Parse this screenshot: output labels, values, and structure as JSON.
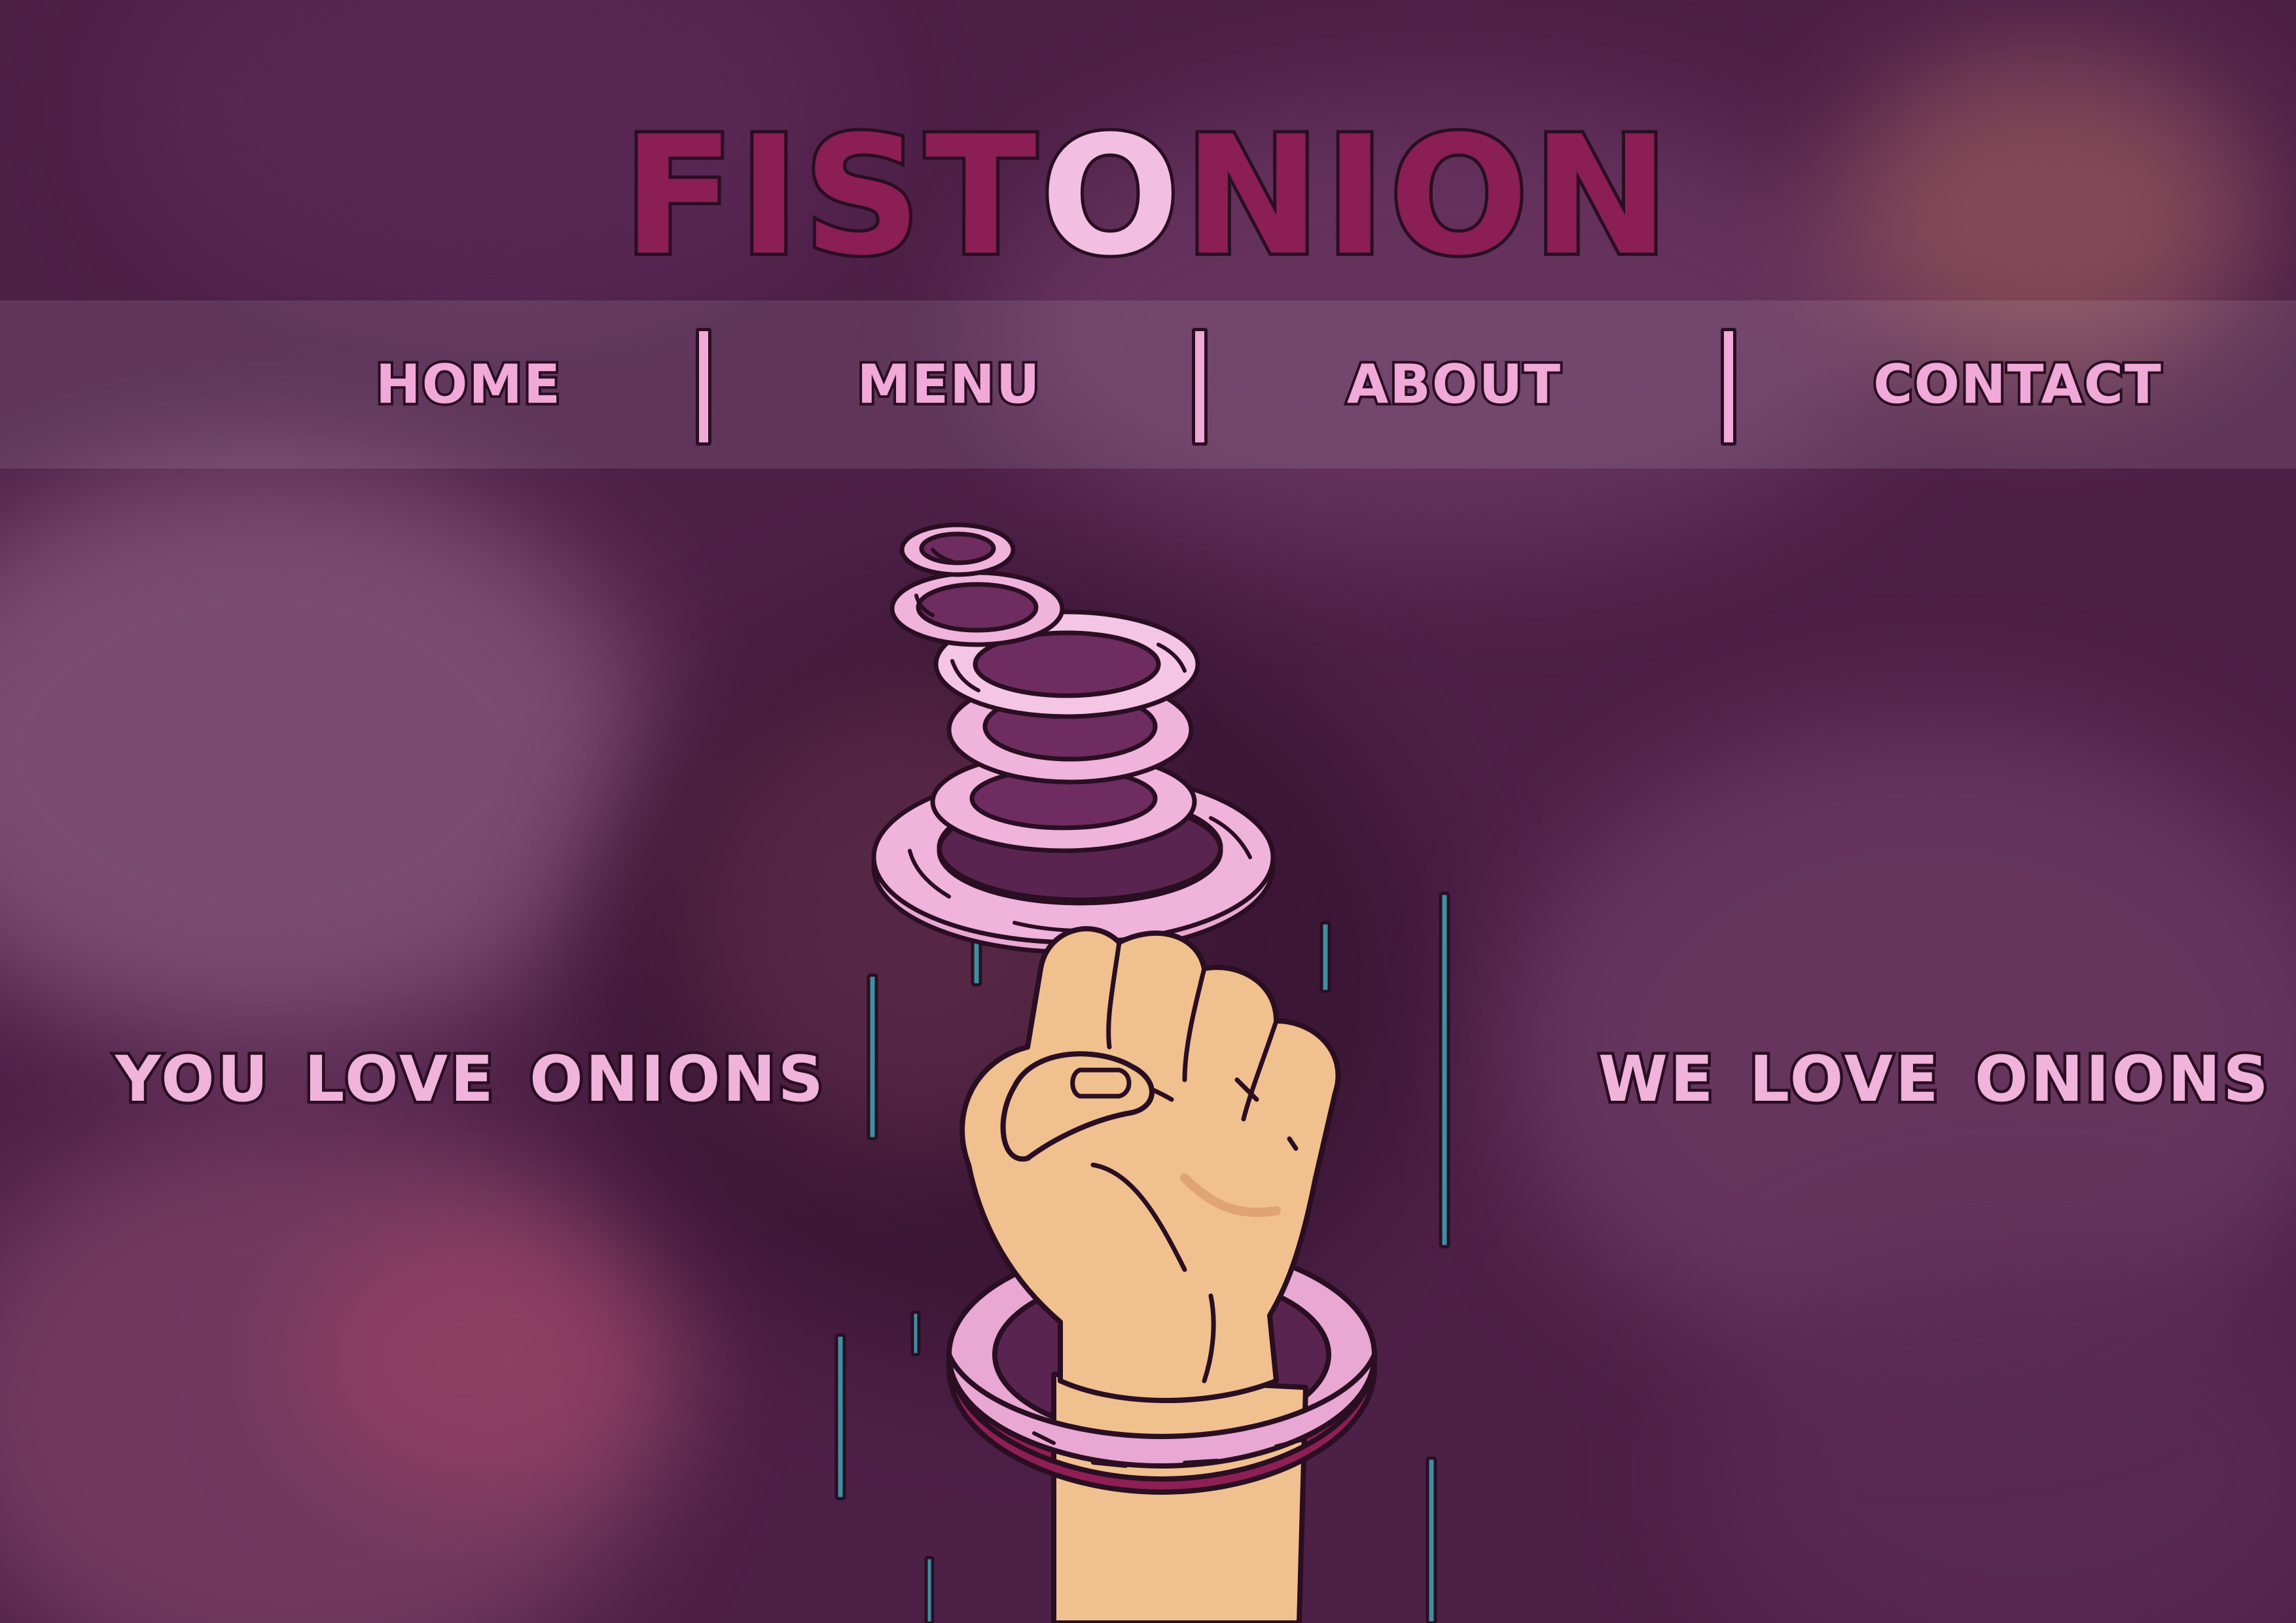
{
  "brand": {
    "logo": {
      "part1": "FIST",
      "part2": "O",
      "part3": "NION"
    }
  },
  "nav": {
    "items": [
      {
        "label": "HOME"
      },
      {
        "label": "MENU"
      },
      {
        "label": "ABOUT"
      },
      {
        "label": "CONTACT"
      }
    ]
  },
  "hero": {
    "tagline_left": "YOU LOVE ONIONS",
    "tagline_right": "WE LOVE ONIONS"
  },
  "icons": {
    "illustration": "fist-with-onion-rings"
  },
  "colors": {
    "background": "#4a1f45",
    "logo_fill": "#8a1e55",
    "text_pink": "#f0a9d8",
    "outline": "#2a0e22",
    "ring_pink": "#f0b3dc",
    "skin": "#f0c08f",
    "speed_line": "#3f8fa3"
  }
}
